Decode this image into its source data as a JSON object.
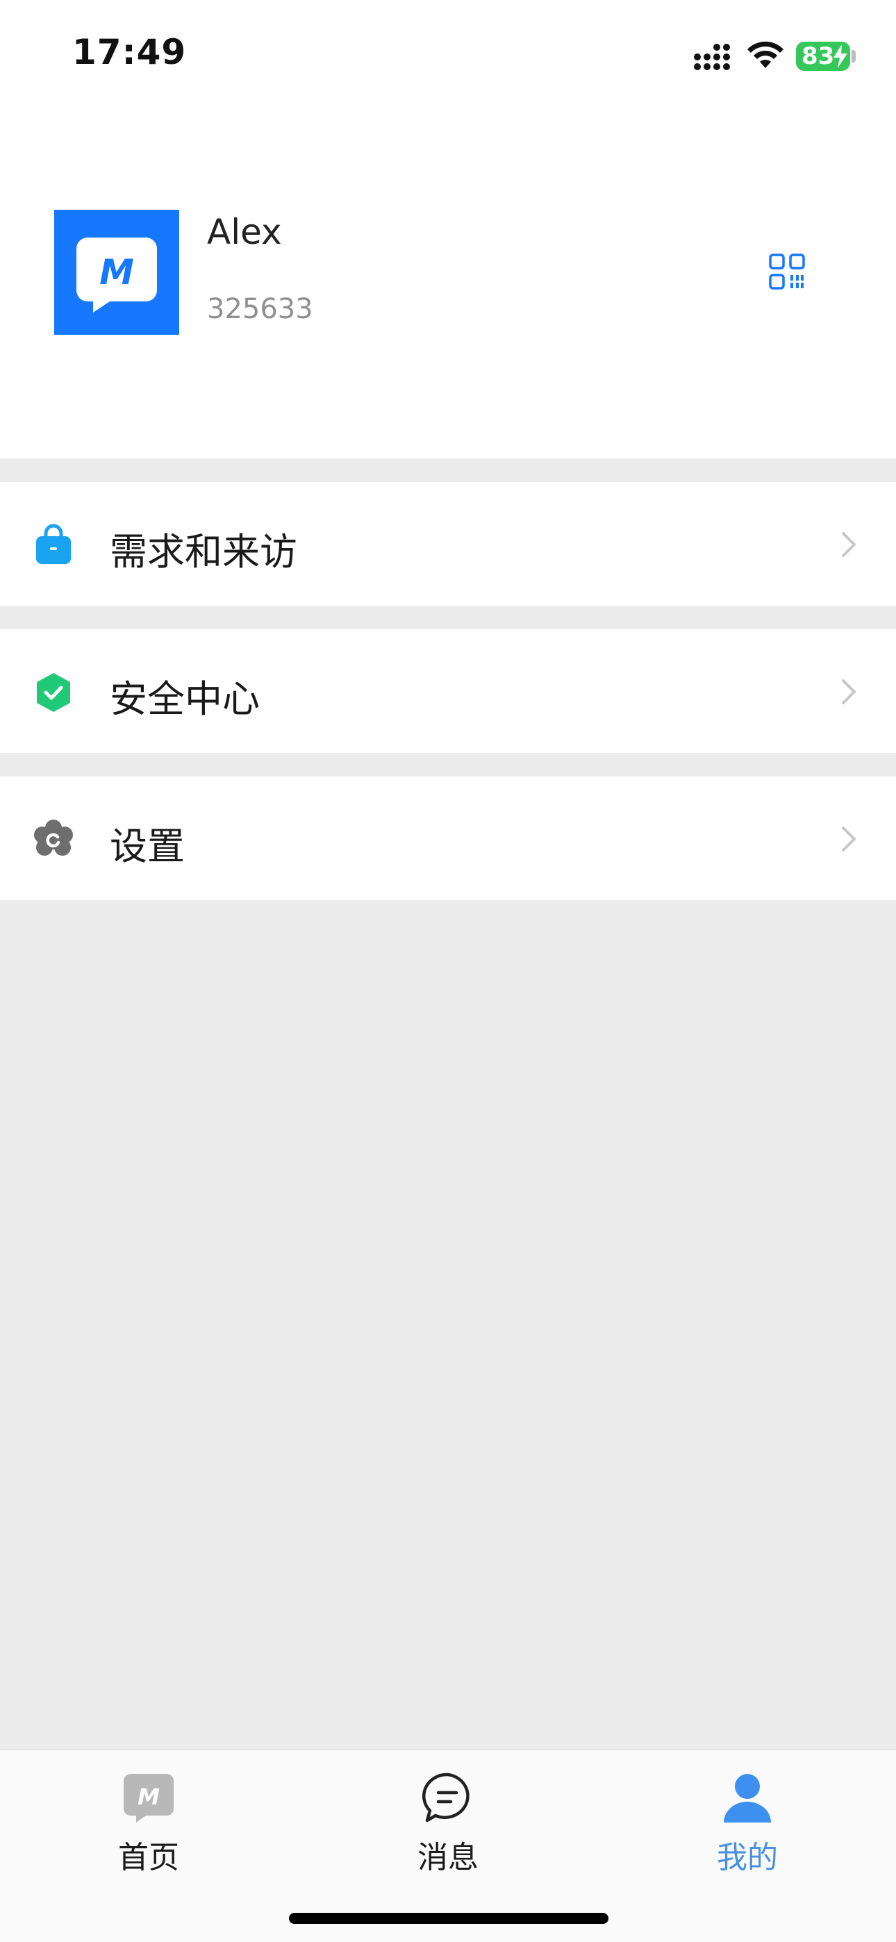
{
  "status_bar": {
    "time": "17:49",
    "battery": "83"
  },
  "profile": {
    "avatar_letter": "M",
    "name": "Alex",
    "id": "325633"
  },
  "menu": {
    "items": [
      {
        "label": "需求和来访",
        "icon": "shopping-bag-icon",
        "color": "#1aa3f0"
      },
      {
        "label": "安全中心",
        "icon": "shield-check-icon",
        "color": "#20c977"
      },
      {
        "label": "设置",
        "icon": "settings-gear-icon",
        "color": "#6e6e6e"
      }
    ]
  },
  "tab_bar": {
    "tabs": [
      {
        "label": "首页",
        "icon": "home-m-icon",
        "active": false
      },
      {
        "label": "消息",
        "icon": "message-bubble-icon",
        "active": false
      },
      {
        "label": "我的",
        "icon": "person-icon",
        "active": true
      }
    ]
  },
  "colors": {
    "accent": "#4a90e2",
    "brand": "#1677ff",
    "background": "#ececec"
  }
}
